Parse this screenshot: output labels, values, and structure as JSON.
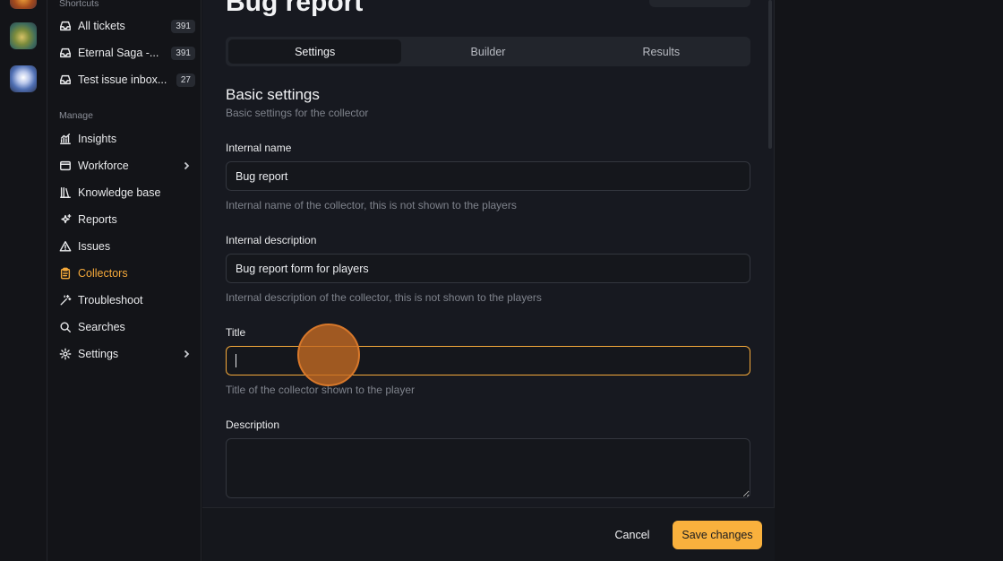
{
  "colors": {
    "accent": "#f5a93a",
    "save_button": "#f9b13d",
    "background": "#171920",
    "sidebar_bg": "#131418"
  },
  "sidebar": {
    "shortcuts_label": "Shortcuts",
    "shortcuts": [
      {
        "label": "All tickets",
        "badge": "391",
        "icon": "inbox-icon"
      },
      {
        "label": "Eternal Saga -...",
        "badge": "391",
        "icon": "inbox-icon"
      },
      {
        "label": "Test issue inbox...",
        "badge": "27",
        "icon": "inbox-icon"
      }
    ],
    "manage_label": "Manage",
    "items": [
      {
        "label": "Insights",
        "icon": "chart-icon"
      },
      {
        "label": "Workforce",
        "icon": "window-icon",
        "has_chevron": true
      },
      {
        "label": "Knowledge base",
        "icon": "library-icon"
      },
      {
        "label": "Reports",
        "icon": "sparkles-icon"
      },
      {
        "label": "Issues",
        "icon": "warning-icon"
      },
      {
        "label": "Collectors",
        "icon": "clipboard-icon",
        "active": true
      },
      {
        "label": "Troubleshoot",
        "icon": "wand-icon"
      },
      {
        "label": "Searches",
        "icon": "search-icon"
      },
      {
        "label": "Settings",
        "icon": "gear-icon",
        "has_chevron": true
      }
    ]
  },
  "main": {
    "title": "Bug report",
    "tabs": [
      {
        "label": "Settings",
        "selected": true
      },
      {
        "label": "Builder",
        "selected": false
      },
      {
        "label": "Results",
        "selected": false
      }
    ],
    "section_title": "Basic settings",
    "section_subtitle": "Basic settings for the collector",
    "fields": {
      "internal_name": {
        "label": "Internal name",
        "value": "Bug report",
        "help": "Internal name of the collector, this is not shown to the players"
      },
      "internal_description": {
        "label": "Internal description",
        "value": "Bug report form for players",
        "help": "Internal description of the collector, this is not shown to the players"
      },
      "title": {
        "label": "Title",
        "value": "",
        "help": "Title of the collector shown to the player"
      },
      "description": {
        "label": "Description",
        "value": ""
      }
    },
    "footer": {
      "cancel_label": "Cancel",
      "save_label": "Save changes"
    }
  }
}
